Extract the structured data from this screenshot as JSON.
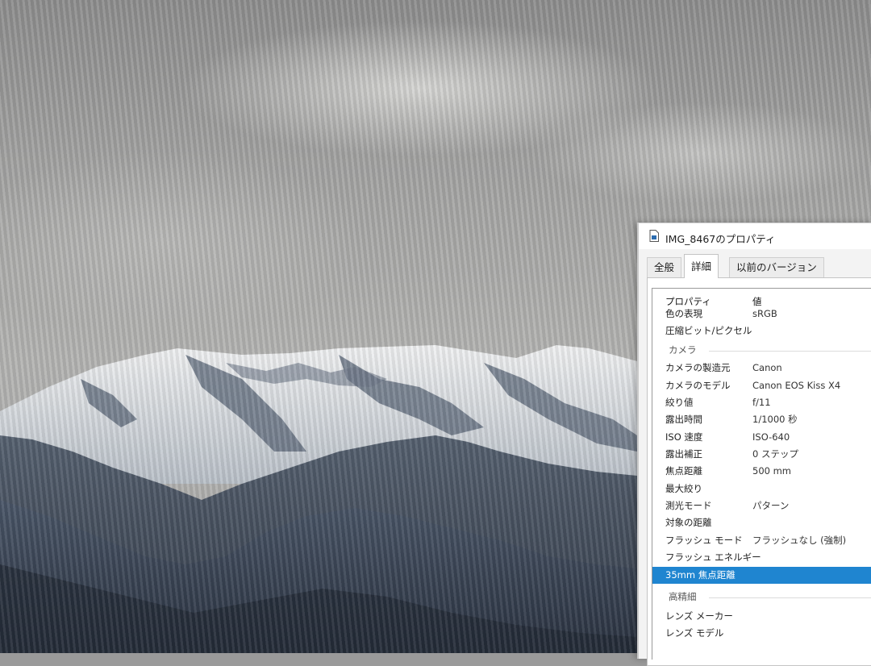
{
  "dialog": {
    "title": "IMG_8467のプロパティ",
    "tabs": [
      {
        "label": "全般",
        "selected": false
      },
      {
        "label": "詳細",
        "selected": true
      },
      {
        "label": "以前のバージョン",
        "selected": false
      }
    ],
    "columns": {
      "property": "プロパティ",
      "value": "値"
    },
    "rows": [
      {
        "type": "item",
        "name": "色の表現",
        "value": "sRGB"
      },
      {
        "type": "item",
        "name": "圧縮ビット/ピクセル",
        "value": ""
      },
      {
        "type": "group",
        "name": "カメラ",
        "value": ""
      },
      {
        "type": "item",
        "name": "カメラの製造元",
        "value": "Canon"
      },
      {
        "type": "item",
        "name": "カメラのモデル",
        "value": "Canon EOS Kiss X4"
      },
      {
        "type": "item",
        "name": "絞り値",
        "value": "f/11"
      },
      {
        "type": "item",
        "name": "露出時間",
        "value": "1/1000 秒"
      },
      {
        "type": "item",
        "name": "ISO 速度",
        "value": "ISO-640"
      },
      {
        "type": "item",
        "name": "露出補正",
        "value": "0 ステップ"
      },
      {
        "type": "item",
        "name": "焦点距離",
        "value": "500 mm"
      },
      {
        "type": "item",
        "name": "最大絞り",
        "value": ""
      },
      {
        "type": "item",
        "name": "測光モード",
        "value": "パターン"
      },
      {
        "type": "item",
        "name": "対象の距離",
        "value": ""
      },
      {
        "type": "item",
        "name": "フラッシュ モード",
        "value": "フラッシュなし (強制)"
      },
      {
        "type": "item",
        "name": "フラッシュ エネルギー",
        "value": ""
      },
      {
        "type": "item",
        "name": "35mm 焦点距離",
        "value": "",
        "selected": true
      },
      {
        "type": "group",
        "name": "高精細",
        "value": ""
      },
      {
        "type": "item",
        "name": "レンズ メーカー",
        "value": ""
      },
      {
        "type": "item",
        "name": "レンズ モデル",
        "value": ""
      }
    ]
  },
  "colors": {
    "selection": "#1f85d0",
    "snow": "#e6e8ea",
    "rock": "#3e4a5a",
    "forest": "#2c3544"
  },
  "icons": {
    "file": "image-file-icon"
  }
}
